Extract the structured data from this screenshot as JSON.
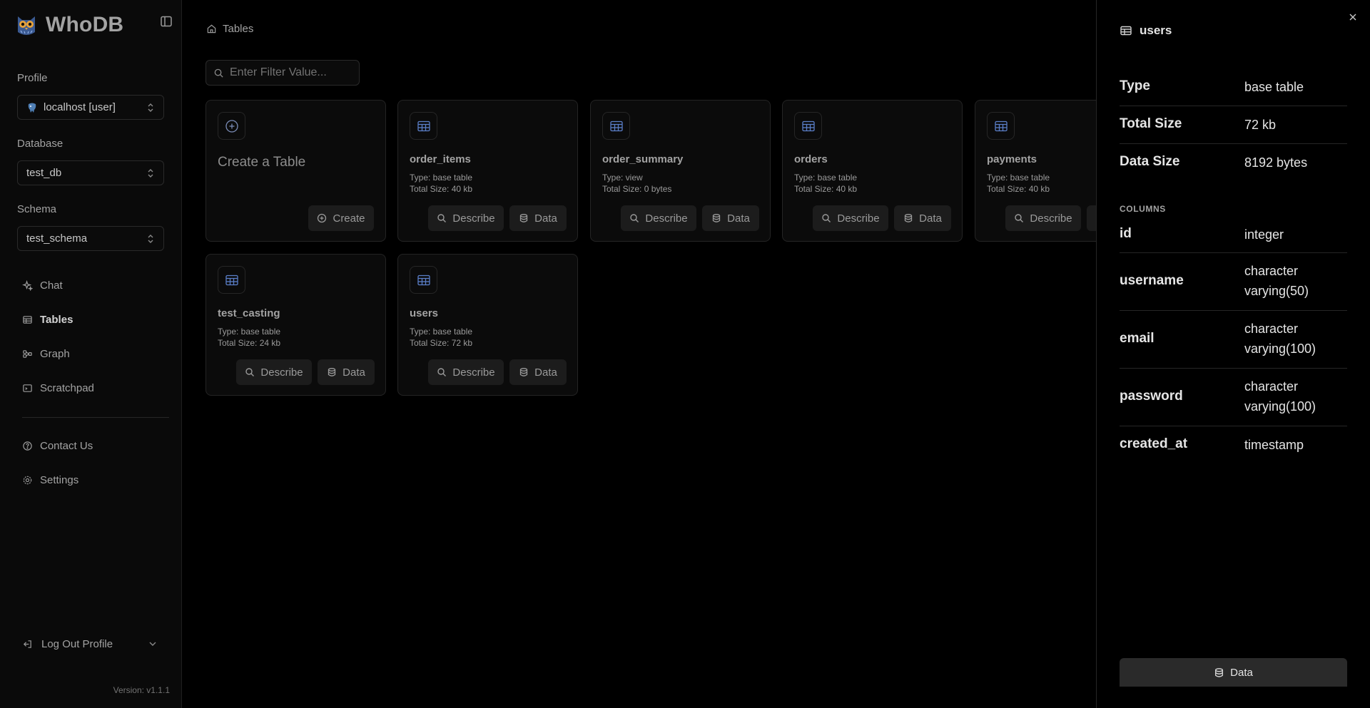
{
  "app": {
    "title": "WhoDB",
    "version": "Version: v1.1.1"
  },
  "sidebar": {
    "profile_label": "Profile",
    "profile_value": "localhost [user]",
    "database_label": "Database",
    "database_value": "test_db",
    "schema_label": "Schema",
    "schema_value": "test_schema",
    "nav": [
      {
        "label": "Chat",
        "icon": "sparkles-icon"
      },
      {
        "label": "Tables",
        "icon": "table-icon",
        "active": true
      },
      {
        "label": "Graph",
        "icon": "graph-icon"
      },
      {
        "label": "Scratchpad",
        "icon": "terminal-icon"
      }
    ],
    "footer_nav": [
      {
        "label": "Contact Us",
        "icon": "help-circle-icon"
      },
      {
        "label": "Settings",
        "icon": "gear-icon"
      }
    ],
    "logout_label": "Log Out Profile"
  },
  "main": {
    "breadcrumb": "Tables",
    "filter_placeholder": "Enter Filter Value...",
    "create_card": {
      "title": "Create a Table",
      "button": "Create"
    },
    "describe_label": "Describe",
    "data_label": "Data",
    "tables": [
      {
        "name": "order_items",
        "type": "Type: base table",
        "size": "Total Size: 40 kb"
      },
      {
        "name": "order_summary",
        "type": "Type: view",
        "size": "Total Size: 0 bytes"
      },
      {
        "name": "orders",
        "type": "Type: base table",
        "size": "Total Size: 40 kb"
      },
      {
        "name": "payments",
        "type": "Type: base table",
        "size": "Total Size: 40 kb"
      },
      {
        "name": "test_casting",
        "type": "Type: base table",
        "size": "Total Size: 24 kb"
      },
      {
        "name": "users",
        "type": "Type: base table",
        "size": "Total Size: 72 kb"
      }
    ]
  },
  "panel": {
    "title": "users",
    "props": [
      {
        "key": "Type",
        "value": "base table"
      },
      {
        "key": "Total Size",
        "value": "72 kb"
      },
      {
        "key": "Data Size",
        "value": "8192 bytes"
      }
    ],
    "columns_label": "COLUMNS",
    "columns": [
      {
        "name": "id",
        "type": "integer"
      },
      {
        "name": "username",
        "type": "character varying(50)"
      },
      {
        "name": "email",
        "type": "character varying(100)"
      },
      {
        "name": "password",
        "type": "character varying(100)"
      },
      {
        "name": "created_at",
        "type": "timestamp"
      }
    ],
    "data_button": "Data"
  },
  "colors": {
    "accent_icon": "#5b7fc9",
    "background": "#000000",
    "sidebar_bg": "#0a0a0a"
  }
}
